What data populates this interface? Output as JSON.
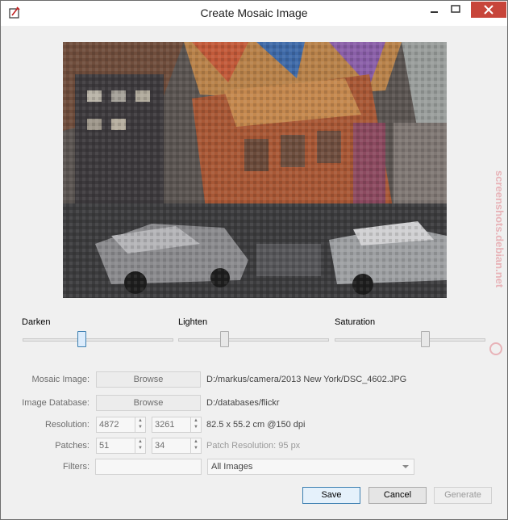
{
  "window": {
    "title": "Create Mosaic Image"
  },
  "sliders": [
    {
      "label": "Darken",
      "level": 0.25
    },
    {
      "label": "Lighten",
      "level": 0.31
    },
    {
      "label": "Saturation",
      "level": 0.6
    }
  ],
  "form": {
    "mosaic_image": {
      "label": "Mosaic Image:",
      "button": "Browse",
      "path": "D:/markus/camera/2013 New York/DSC_4602.JPG"
    },
    "image_database": {
      "label": "Image Database:",
      "button": "Browse",
      "path": "D:/databases/flickr"
    },
    "resolution": {
      "label": "Resolution:",
      "width": "4872",
      "height": "3261",
      "info": "82.5 x 55.2 cm @150 dpi"
    },
    "patches": {
      "label": "Patches:",
      "cols": "51",
      "rows": "34",
      "info": "Patch Resolution: 95 px"
    },
    "filters": {
      "label": "Filters:",
      "value": "",
      "combo": "All Images"
    }
  },
  "buttons": {
    "save": "Save",
    "cancel": "Cancel",
    "generate": "Generate"
  },
  "watermark": {
    "text": "screenshots.debian.net"
  },
  "colors": {
    "accent": "#3c7fb1",
    "close": "#c7453a"
  }
}
